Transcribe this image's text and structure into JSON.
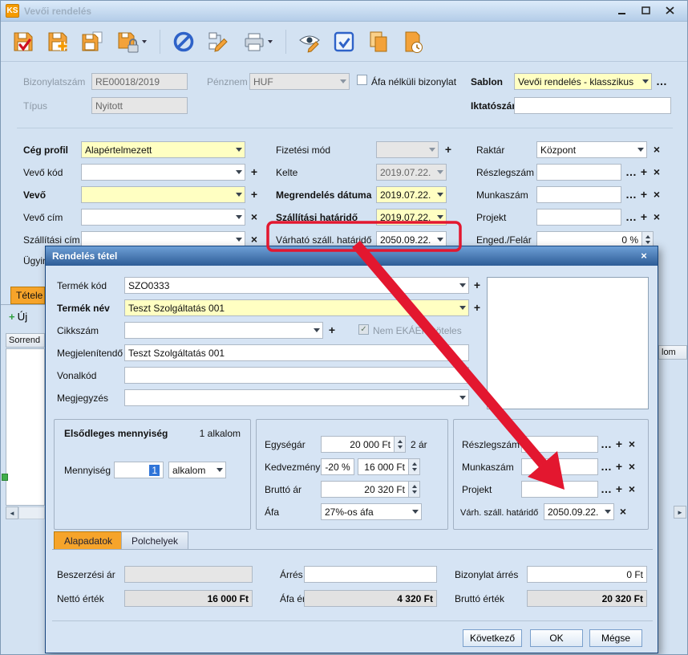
{
  "glyphs": {
    "plus": "+",
    "close": "×",
    "more": "…",
    "check": "✓",
    "left": "◄",
    "right": "►"
  },
  "titlebar": {
    "badge": "KS",
    "title": "Vevői rendelés"
  },
  "toolbar": {
    "icons": [
      "save",
      "save-new",
      "save-copy",
      "save-lock",
      "cancel",
      "transfer",
      "print",
      "view-edit",
      "select",
      "copy-document",
      "document-history"
    ]
  },
  "header": {
    "bizonylatszam_label": "Bizonylatszám",
    "bizonylatszam_value": "RE00018/2019",
    "penznem_label": "Pénznem",
    "penznem_value": "HUF",
    "afa_checkbox_label": "Áfa nélküli bizonylat",
    "sablon_label": "Sablon",
    "sablon_value": "Vevői rendelés - klasszikus",
    "tipus_label": "Típus",
    "tipus_value": "Nyitott",
    "iktatoszam_label": "Iktatószám",
    "iktatoszam_value": ""
  },
  "left_panel": {
    "ceg_profil_label": "Cég profil",
    "ceg_profil_value": "Alapértelmezett",
    "vevo_kod_label": "Vevő kód",
    "vevo_label": "Vevő",
    "vevo_cim_label": "Vevő cím",
    "szallitasi_cim_label": "Szállítási cím",
    "ugyintezo_label": "Ügyint"
  },
  "mid_panel": {
    "fizetesi_mod_label": "Fizetési mód",
    "kelte_label": "Kelte",
    "kelte_value": "2019.07.22.",
    "megrendeles_label": "Megrendelés dátuma",
    "megrendeles_value": "2019.07.22.",
    "szall_hatarido_label": "Szállítási határidő",
    "szall_hatarido_value": "2019.07.22.",
    "varhato_label": "Várható száll. határidő",
    "varhato_value": "2050.09.22."
  },
  "right_panel": {
    "raktar_label": "Raktár",
    "raktar_value": "Központ",
    "reszlegszam_label": "Részlegszám",
    "munkaszam_label": "Munkaszám",
    "projekt_label": "Projekt",
    "enged_label": "Enged./Felár",
    "enged_value": "0 %"
  },
  "background": {
    "tetelek_tab": "Tétele",
    "uj_button": "Új",
    "sorrend_header": "Sorrend",
    "alkalom_fragment": "lom"
  },
  "dialog": {
    "title": "Rendelés tétel",
    "termek_kod_label": "Termék kód",
    "termek_kod_value": "SZO0333",
    "termek_nev_label": "Termék név",
    "termek_nev_value": "Teszt Szolgáltatás 001",
    "cikkszam_label": "Cikkszám",
    "ekaer_label": "Nem EKÁER köteles",
    "megjelenitendo_label": "Megjelenítendő",
    "megjelenitendo_value": "Teszt Szolgáltatás 001",
    "vonalkod_label": "Vonalkód",
    "megjegyzes_label": "Megjegyzés",
    "mennyiseg_group": {
      "title": "Elsődleges mennyiség",
      "occurrence": "1 alkalom",
      "mennyiseg_label": "Mennyiség",
      "mennyiseg_value": "1",
      "unit_value": "alkalom"
    },
    "price_group": {
      "egysegar_label": "Egységár",
      "egysegar_value": "20 000 Ft",
      "price_count": "2 ár",
      "kedvezmeny_label": "Kedvezmény",
      "kedvezmeny_pct": "-20 %",
      "kedvezmeny_value": "16 000 Ft",
      "brutto_ar_label": "Bruttó ár",
      "brutto_ar_value": "20 320 Ft",
      "afa_label": "Áfa",
      "afa_value": "27%-os áfa"
    },
    "assign_group": {
      "reszlegszam_label": "Részlegszám",
      "munkaszam_label": "Munkaszám",
      "projekt_label": "Projekt",
      "varh_szall_label": "Várh. száll. határidő",
      "varh_szall_value": "2050.09.22."
    },
    "tabs": {
      "alapadatok": "Alapadatok",
      "polchelyek": "Polchelyek"
    },
    "totals": {
      "beszerzesi_label": "Beszerzési ár",
      "beszerzesi_value": "",
      "arres_label": "Árrés",
      "arres_value": "",
      "bizonylat_arres_label": "Bizonylat árrés",
      "bizonylat_arres_value": "0 Ft",
      "netto_label": "Nettó érték",
      "netto_value": "16 000 Ft",
      "afa_ertek_label": "Áfa érték",
      "afa_ertek_value": "4 320 Ft",
      "brutto_label": "Bruttó érték",
      "brutto_value": "20 320 Ft"
    },
    "buttons": {
      "next": "Következő",
      "ok": "OK",
      "cancel": "Mégse"
    }
  }
}
